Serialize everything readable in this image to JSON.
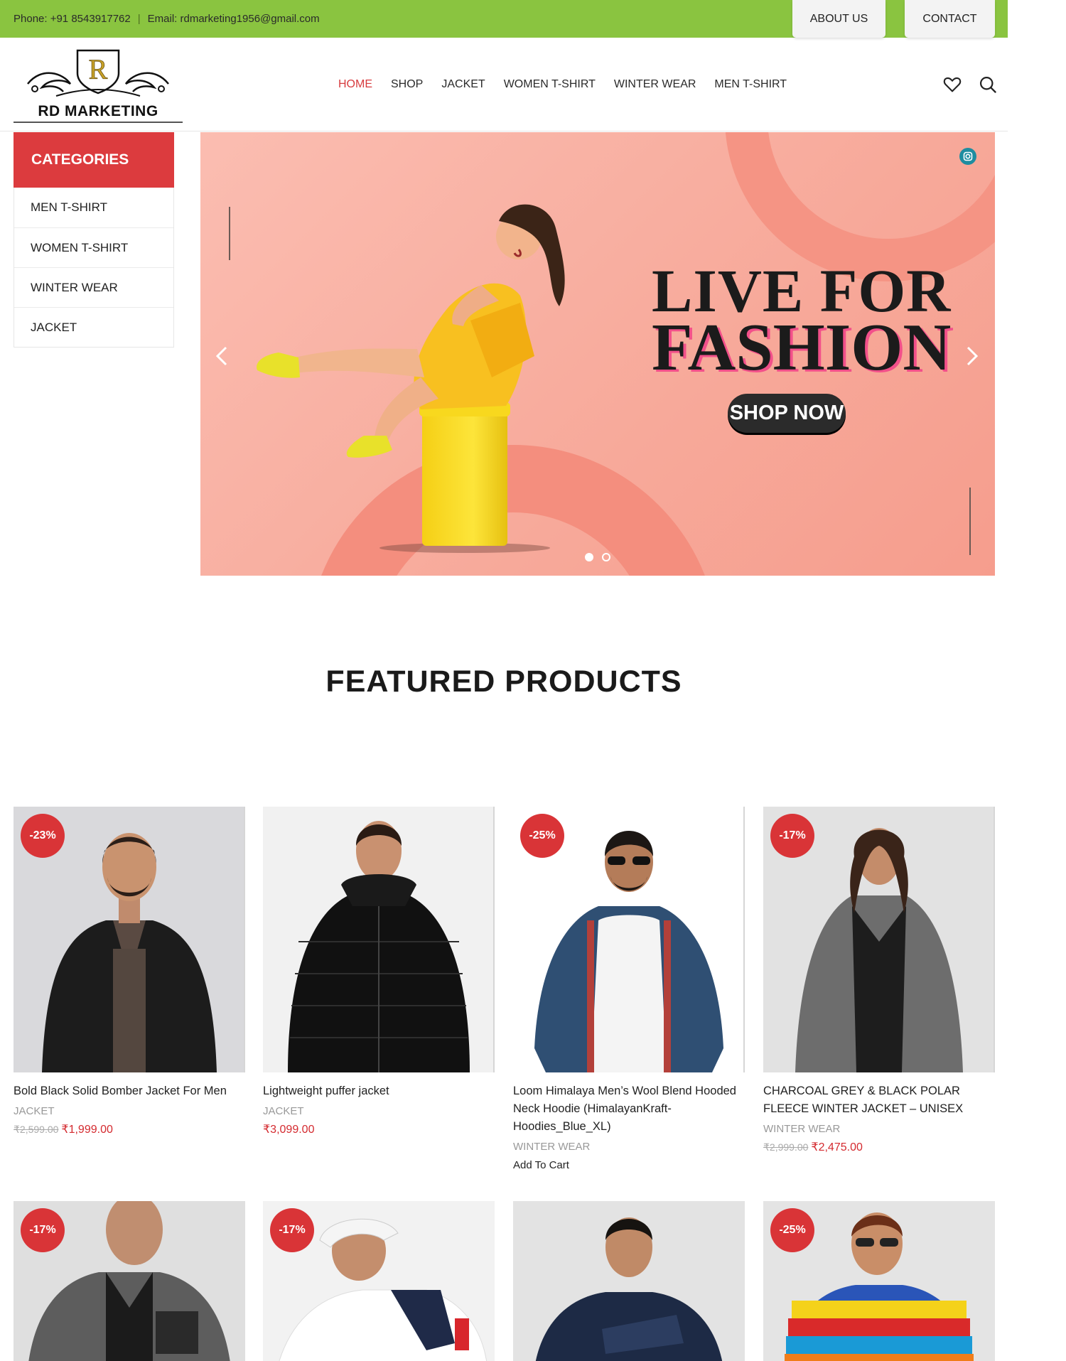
{
  "topbar": {
    "phone": "Phone: +91 8543917762",
    "separator": "|",
    "email": "Email: rdmarketing1956@gmail.com",
    "about_label": "ABOUT US",
    "contact_label": "CONTACT"
  },
  "header": {
    "logo_text": "RD MARKETING",
    "nav": [
      "HOME",
      "SHOP",
      "JACKET",
      "WOMEN T-SHIRT",
      "WINTER WEAR",
      "MEN T-SHIRT"
    ],
    "active_nav": "HOME",
    "icons": [
      "heart-icon",
      "search-icon"
    ]
  },
  "categories": {
    "title": "CATEGORIES",
    "items": [
      "MEN T-SHIRT",
      "WOMEN T-SHIRT",
      "WINTER WEAR",
      "JACKET"
    ]
  },
  "hero": {
    "line1": "LIVE FOR",
    "line2": "FASHION",
    "cta": "SHOP NOW",
    "slides": 2,
    "active_slide": 1
  },
  "featured": {
    "title": "FEATURED PRODUCTS",
    "products": [
      {
        "badge": "-23%",
        "name": "Bold Black Solid Bomber Jacket For Men",
        "category": "JACKET",
        "old_price": "₹2,599.00",
        "price": "₹1,999.00"
      },
      {
        "badge": "",
        "name": "Lightweight puffer jacket",
        "category": "JACKET",
        "old_price": "",
        "price": "₹3,099.00"
      },
      {
        "badge": "-25%",
        "name": "Loom Himalaya Men’s Wool Blend Hooded Neck Hoodie (HimalayanKraft-Hoodies_Blue_XL)",
        "category": "WINTER WEAR",
        "old_price": "",
        "price": "",
        "action": "Add To Cart"
      },
      {
        "badge": "-17%",
        "name": "CHARCOAL GREY & BLACK POLAR FLEECE WINTER JACKET – UNISEX",
        "category": "WINTER WEAR",
        "old_price": "₹2,999.00",
        "price": "₹2,475.00"
      }
    ],
    "row2_badges": [
      "-17%",
      "-17%",
      "",
      "-25%"
    ]
  },
  "colors": {
    "topbar": "#8ac440",
    "accent_red": "#dc3b3e",
    "hero_bg": "#f8ab9c"
  }
}
